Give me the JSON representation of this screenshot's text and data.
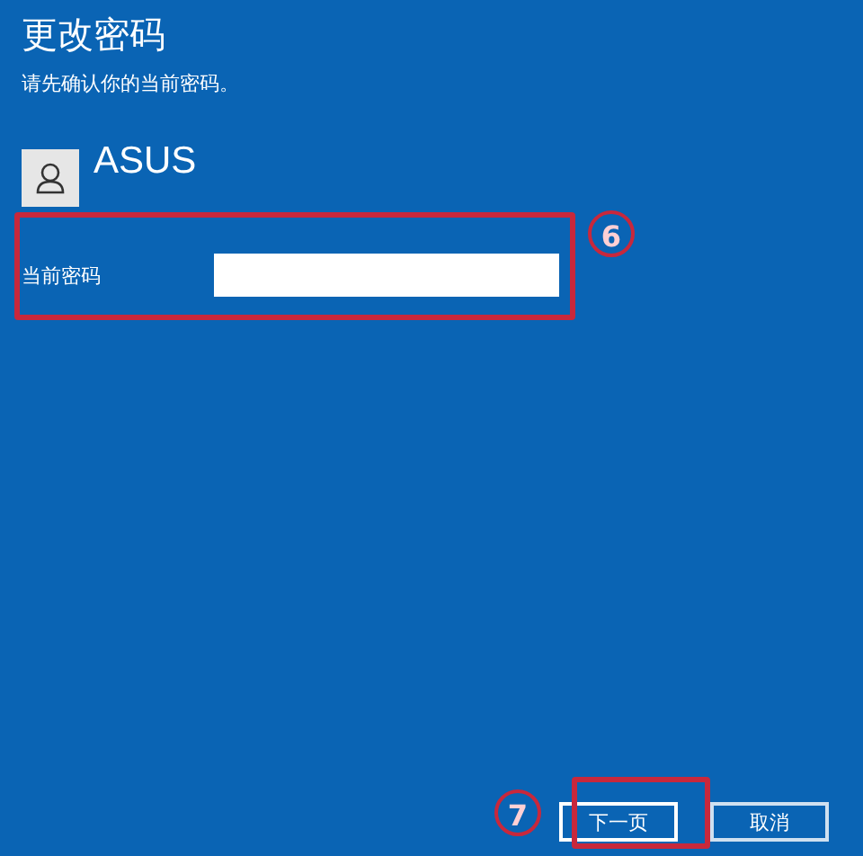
{
  "title": "更改密码",
  "subtitle": "请先确认你的当前密码。",
  "account": {
    "name": "ASUS"
  },
  "field": {
    "label": "当前密码",
    "step": "6"
  },
  "buttons": [
    {
      "label": "下一页",
      "focused": true,
      "step": "7"
    },
    {
      "label": "取消",
      "focused": false
    }
  ]
}
